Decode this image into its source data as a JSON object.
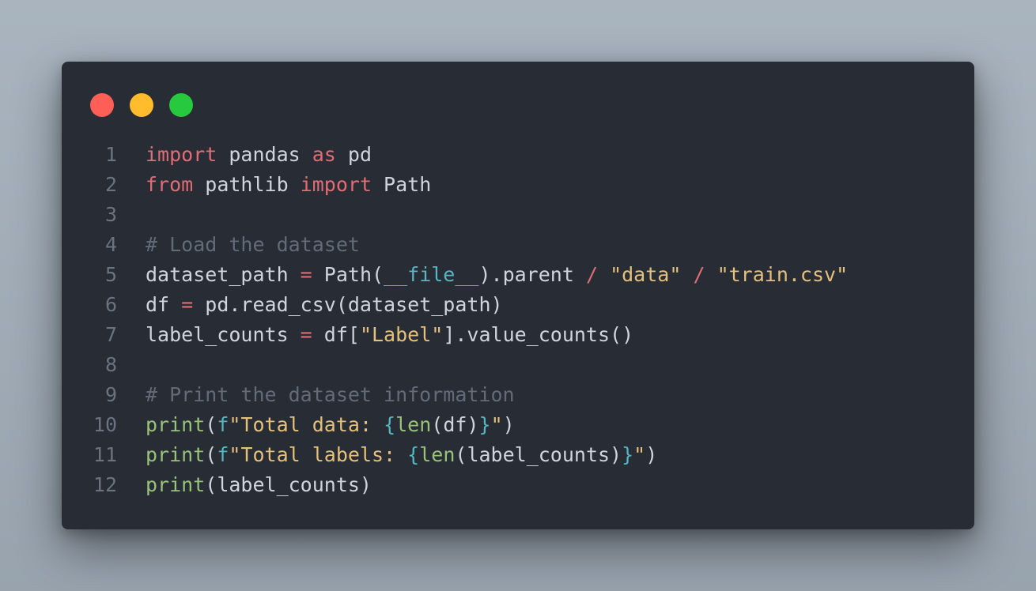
{
  "window": {
    "controls": [
      "close",
      "minimize",
      "maximize"
    ],
    "colors": {
      "background": "#282c35",
      "close": "#ff5f56",
      "minimize": "#ffbd2e",
      "maximize": "#27c93f"
    }
  },
  "syntax_colors": {
    "keyword": "#e06c75",
    "string": "#e5c07b",
    "function": "#98c379",
    "builtin": "#56b6c2",
    "comment": "#636b78",
    "text": "#d1d5db",
    "line_number": "#6b7280"
  },
  "lines": [
    {
      "n": "1",
      "tokens": [
        [
          "kw",
          "import"
        ],
        [
          "tx",
          " pandas "
        ],
        [
          "kw",
          "as"
        ],
        [
          "tx",
          " pd"
        ]
      ]
    },
    {
      "n": "2",
      "tokens": [
        [
          "kw",
          "from"
        ],
        [
          "tx",
          " pathlib "
        ],
        [
          "kw",
          "import"
        ],
        [
          "tx",
          " Path"
        ]
      ]
    },
    {
      "n": "3",
      "tokens": []
    },
    {
      "n": "4",
      "tokens": [
        [
          "cm",
          "# Load the dataset"
        ]
      ]
    },
    {
      "n": "5",
      "tokens": [
        [
          "tx",
          "dataset_path "
        ],
        [
          "op",
          "="
        ],
        [
          "tx",
          " Path("
        ],
        [
          "bi",
          "__file__"
        ],
        [
          "tx",
          ").parent "
        ],
        [
          "op",
          "/"
        ],
        [
          "tx",
          " "
        ],
        [
          "str",
          "\"data\""
        ],
        [
          "tx",
          " "
        ],
        [
          "op",
          "/"
        ],
        [
          "tx",
          " "
        ],
        [
          "str",
          "\"train.csv\""
        ]
      ]
    },
    {
      "n": "6",
      "tokens": [
        [
          "tx",
          "df "
        ],
        [
          "op",
          "="
        ],
        [
          "tx",
          " pd.read_csv(dataset_path)"
        ]
      ]
    },
    {
      "n": "7",
      "tokens": [
        [
          "tx",
          "label_counts "
        ],
        [
          "op",
          "="
        ],
        [
          "tx",
          " df["
        ],
        [
          "str",
          "\"Label\""
        ],
        [
          "tx",
          "].value_counts()"
        ]
      ]
    },
    {
      "n": "8",
      "tokens": []
    },
    {
      "n": "9",
      "tokens": [
        [
          "cm",
          "# Print the dataset information"
        ]
      ]
    },
    {
      "n": "10",
      "tokens": [
        [
          "fn",
          "print"
        ],
        [
          "tx",
          "("
        ],
        [
          "bi",
          "f"
        ],
        [
          "str",
          "\"Total data: "
        ],
        [
          "bi",
          "{"
        ],
        [
          "fn",
          "len"
        ],
        [
          "tx",
          "(df)"
        ],
        [
          "bi",
          "}"
        ],
        [
          "str",
          "\""
        ],
        [
          "tx",
          ")"
        ]
      ]
    },
    {
      "n": "11",
      "tokens": [
        [
          "fn",
          "print"
        ],
        [
          "tx",
          "("
        ],
        [
          "bi",
          "f"
        ],
        [
          "str",
          "\"Total labels: "
        ],
        [
          "bi",
          "{"
        ],
        [
          "fn",
          "len"
        ],
        [
          "tx",
          "(label_counts)"
        ],
        [
          "bi",
          "}"
        ],
        [
          "str",
          "\""
        ],
        [
          "tx",
          ")"
        ]
      ]
    },
    {
      "n": "12",
      "tokens": [
        [
          "fn",
          "print"
        ],
        [
          "tx",
          "(label_counts)"
        ]
      ]
    }
  ]
}
